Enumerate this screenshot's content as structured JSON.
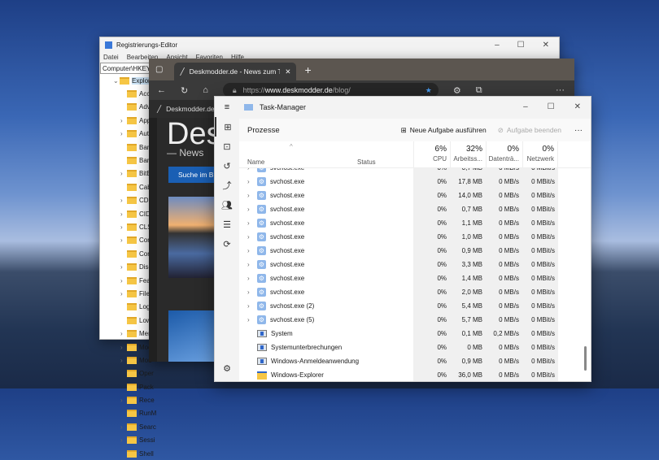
{
  "registry": {
    "title": "Registrierungs-Editor",
    "menu": [
      "Datei",
      "Bearbeiten",
      "Ansicht",
      "Favoriten",
      "Hilfe"
    ],
    "address": "Computer\\HKEY_C",
    "tree": [
      {
        "label": "Explorer",
        "exp": "open"
      },
      {
        "label": "Acce"
      },
      {
        "label": "Adva"
      },
      {
        "label": "AppC",
        "exp": "closed"
      },
      {
        "label": "Auto",
        "exp": "closed"
      },
      {
        "label": "Bam"
      },
      {
        "label": "Banr"
      },
      {
        "label": "BitBu",
        "exp": "closed"
      },
      {
        "label": "Cabi"
      },
      {
        "label": "CD B",
        "exp": "closed"
      },
      {
        "label": "CIDS",
        "exp": "closed"
      },
      {
        "label": "CLSII",
        "exp": "closed"
      },
      {
        "label": "Com",
        "exp": "closed"
      },
      {
        "label": "Cont"
      },
      {
        "label": "Disca",
        "exp": "closed"
      },
      {
        "label": "Featu",
        "exp": "closed"
      },
      {
        "label": "FileE",
        "exp": "closed"
      },
      {
        "label": "Logo"
      },
      {
        "label": "LowR"
      },
      {
        "label": "Men",
        "exp": "closed"
      },
      {
        "label": "Mod",
        "exp": "closed"
      },
      {
        "label": "Mou",
        "exp": "closed"
      },
      {
        "label": "Oper"
      },
      {
        "label": "Pack"
      },
      {
        "label": "Rece",
        "exp": "closed"
      },
      {
        "label": "RunM"
      },
      {
        "label": "Searc",
        "exp": "closed"
      },
      {
        "label": "Sessi",
        "exp": "closed"
      },
      {
        "label": "Shell"
      }
    ]
  },
  "browser": {
    "tab_title": "Deskmodder.de - News zum The",
    "url_prefix": "https://",
    "url_host": "www.deskmodder.de",
    "url_path": "/blog/",
    "favorite": "Deskmodder.de |",
    "logo": "Desk",
    "tagline": "News",
    "search_button": "Suche im Bl",
    "accent": "#1a5fb4"
  },
  "taskmanager": {
    "title": "Task-Manager",
    "page": "Prozesse",
    "new_task": "Neue Aufgabe ausführen",
    "end_task": "Aufgabe beenden",
    "more": "···",
    "columns": {
      "name": "Name",
      "status": "Status",
      "cpu_pct": "6%",
      "cpu": "CPU",
      "mem_pct": "32%",
      "mem": "Arbeitss...",
      "disk_pct": "0%",
      "disk": "Datenträ...",
      "net_pct": "0%",
      "net": "Netzwerk"
    },
    "rows": [
      {
        "name": "svchost.exe",
        "icon": "gear",
        "cpu": "0%",
        "mem": "0,7 MB",
        "disk": "0 MB/s",
        "net": "0 MBit/s"
      },
      {
        "name": "svchost.exe",
        "icon": "gear",
        "cpu": "0%",
        "mem": "17,8 MB",
        "disk": "0 MB/s",
        "net": "0 MBit/s"
      },
      {
        "name": "svchost.exe",
        "icon": "gear",
        "cpu": "0%",
        "mem": "14,0 MB",
        "disk": "0 MB/s",
        "net": "0 MBit/s"
      },
      {
        "name": "svchost.exe",
        "icon": "gear",
        "cpu": "0%",
        "mem": "0,7 MB",
        "disk": "0 MB/s",
        "net": "0 MBit/s"
      },
      {
        "name": "svchost.exe",
        "icon": "gear",
        "cpu": "0%",
        "mem": "1,1 MB",
        "disk": "0 MB/s",
        "net": "0 MBit/s"
      },
      {
        "name": "svchost.exe",
        "icon": "gear",
        "cpu": "0%",
        "mem": "1,0 MB",
        "disk": "0 MB/s",
        "net": "0 MBit/s"
      },
      {
        "name": "svchost.exe",
        "icon": "gear",
        "cpu": "0%",
        "mem": "0,9 MB",
        "disk": "0 MB/s",
        "net": "0 MBit/s"
      },
      {
        "name": "svchost.exe",
        "icon": "gear",
        "cpu": "0%",
        "mem": "3,3 MB",
        "disk": "0 MB/s",
        "net": "0 MBit/s"
      },
      {
        "name": "svchost.exe",
        "icon": "gear",
        "cpu": "0%",
        "mem": "1,4 MB",
        "disk": "0 MB/s",
        "net": "0 MBit/s"
      },
      {
        "name": "svchost.exe",
        "icon": "gear",
        "cpu": "0%",
        "mem": "2,0 MB",
        "disk": "0 MB/s",
        "net": "0 MBit/s"
      },
      {
        "name": "svchost.exe (2)",
        "icon": "gear",
        "cpu": "0%",
        "mem": "5,4 MB",
        "disk": "0 MB/s",
        "net": "0 MBit/s"
      },
      {
        "name": "svchost.exe (5)",
        "icon": "gear",
        "cpu": "0%",
        "mem": "5,7 MB",
        "disk": "0 MB/s",
        "net": "0 MBit/s"
      },
      {
        "name": "System",
        "icon": "sys",
        "cpu": "0%",
        "mem": "0,1 MB",
        "disk": "0,2 MB/s",
        "net": "0 MBit/s"
      },
      {
        "name": "Systemunterbrechungen",
        "icon": "sys",
        "cpu": "0%",
        "mem": "0 MB",
        "disk": "0 MB/s",
        "net": "0 MBit/s"
      },
      {
        "name": "Windows-Anmeldeanwendung",
        "icon": "sys",
        "cpu": "0%",
        "mem": "0,9 MB",
        "disk": "0 MB/s",
        "net": "0 MBit/s"
      },
      {
        "name": "Windows-Explorer",
        "icon": "explorer",
        "cpu": "0%",
        "mem": "36,0 MB",
        "disk": "0 MB/s",
        "net": "0 MBit/s"
      }
    ]
  }
}
